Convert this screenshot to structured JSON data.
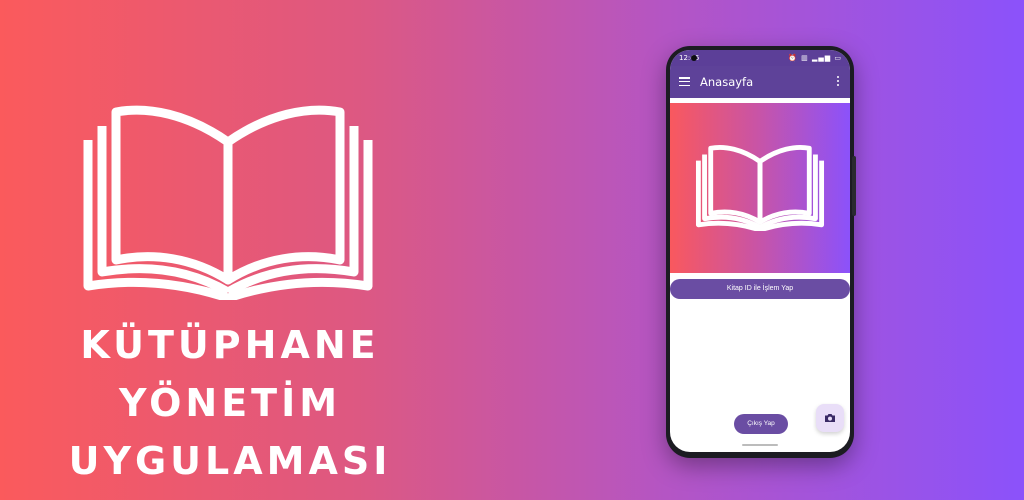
{
  "colors": {
    "gradient_left": "#fb5a5c",
    "gradient_right": "#8b52fb",
    "app_bar": "#5e4299",
    "button": "#6a4da3",
    "fab": "#e9def8"
  },
  "banner": {
    "title_lines": [
      "KÜTÜPHANE",
      "YÖNETİM",
      "UYGULAMASI"
    ],
    "logo_icon": "open-book-icon"
  },
  "phone": {
    "status_bar": {
      "time": "12:46",
      "icons": "⏰ ▥ ▂▄▆ ▭"
    },
    "app_bar": {
      "title": "Anasayfa",
      "menu_icon": "hamburger-menu-icon",
      "more_icon": "more-vert-icon"
    },
    "hero_icon": "open-book-icon",
    "primary_button": "Kitap ID ile İşlem Yap",
    "logout_button": "Çıkış Yap",
    "fab_icon": "camera-icon"
  }
}
